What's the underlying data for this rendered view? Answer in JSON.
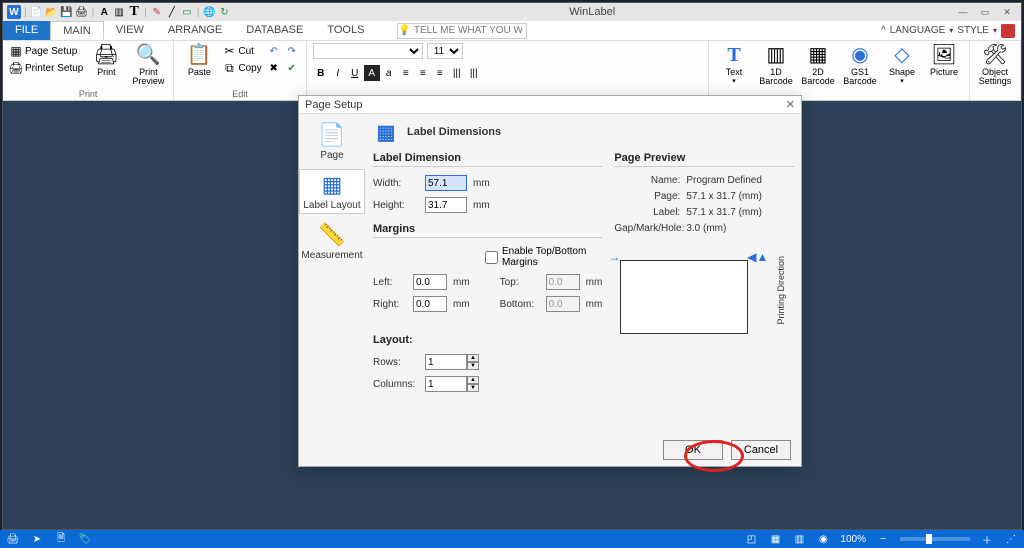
{
  "titlebar": {
    "app_title": "WinLabel"
  },
  "menu": {
    "file": "FILE",
    "main": "MAIN",
    "view": "VIEW",
    "arrange": "ARRANGE",
    "database": "DATABASE",
    "tools": "TOOLS",
    "search_placeholder": "TELL ME WHAT YOU WANT...",
    "language": "LANGUAGE",
    "style": "STYLE"
  },
  "ribbon": {
    "page_setup": "Page Setup",
    "printer_setup": "Printer Setup",
    "print": "Print",
    "print_preview": "Print\nPreview",
    "group_print": "Print",
    "paste": "Paste",
    "cut": "Cut",
    "copy": "Copy",
    "group_edit": "Edit",
    "font_name": "",
    "font_size": "11",
    "text": "Text",
    "barcode1d": "1D\nBarcode",
    "barcode2d": "2D\nBarcode",
    "gs1": "GS1\nBarcode",
    "shape": "Shape",
    "picture": "Picture",
    "object_settings": "Object\nSettings"
  },
  "dialog": {
    "title": "Page Setup",
    "side": {
      "page": "Page",
      "label_layout": "Label Layout",
      "measurement": "Measurement"
    },
    "header": "Label Dimensions",
    "label_dimension": "Label Dimension",
    "width": "Width:",
    "width_val": "57.1",
    "height": "Height:",
    "height_val": "31.7",
    "mm": "mm",
    "margins": "Margins",
    "enable_tb": "Enable Top/Bottom Margins",
    "left": "Left:",
    "left_val": "0.0",
    "right": "Right:",
    "right_val": "0.0",
    "top": "Top:",
    "top_val": "0.0",
    "bottom": "Bottom:",
    "bottom_val": "0.0",
    "layout": "Layout:",
    "rows": "Rows:",
    "rows_val": "1",
    "columns": "Columns:",
    "columns_val": "1",
    "page_preview": "Page Preview",
    "name": "Name:",
    "name_val": "Program Defined",
    "page": "Page:",
    "page_val": "57.1 x 31.7 (mm)",
    "label": "Label:",
    "label_val": "57.1 x 31.7 (mm)",
    "gap": "Gap/Mark/Hole:",
    "gap_val": "3.0 (mm)",
    "print_dir": "Printing Direction",
    "ok": "OK",
    "cancel": "Cancel"
  },
  "statusbar": {
    "zoom": "100%"
  }
}
